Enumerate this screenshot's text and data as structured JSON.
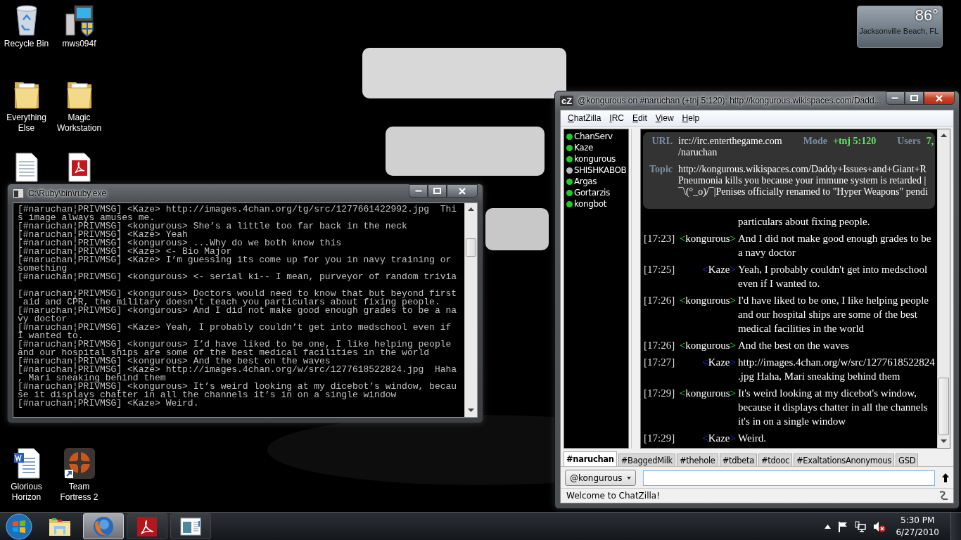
{
  "desktop": {
    "icons": [
      {
        "label": "Recycle Bin",
        "kind": "recycle"
      },
      {
        "label": "mws094f",
        "kind": "computer"
      },
      {
        "label": "Everything Else",
        "kind": "folder"
      },
      {
        "label": "Magic Workstation",
        "kind": "folder"
      },
      {
        "kind": "document"
      },
      {
        "kind": "pdf"
      },
      {
        "label": "Glorious Horizon",
        "kind": "word"
      },
      {
        "label": "Team Fortress 2",
        "kind": "game"
      }
    ]
  },
  "weather_gadget": {
    "temperature": "86°",
    "location": "Jacksonville Beach, FL"
  },
  "console_window": {
    "title": "C:\\Ruby\\bin\\ruby.exe",
    "blocks": [
      [
        "[#naruchan¦PRIVMSG] <Kaze> http://images.4chan.org/tg/src/1277661422992.jpg  Thi",
        "s image always amuses me.",
        "[#naruchan¦PRIVMSG] <kongurous> She’s a little too far back in the neck",
        "[#naruchan¦PRIVMSG] <Kaze> Yeah",
        "[#naruchan¦PRIVMSG] <kongurous> ...Why do we both know this",
        "[#naruchan¦PRIVMSG] <Kaze> <- Bio Major",
        "[#naruchan¦PRIVMSG] <Kaze> I’m guessing its come up for you in navy training or",
        "something",
        "[#naruchan¦PRIVMSG] <kongurous> <- serial ki-- I mean, purveyor of random trivia"
      ],
      [
        "[#naruchan¦PRIVMSG] <kongurous> Doctors would need to know that but beyond first",
        " aid and CPR, the military doesn’t teach you particulars about fixing people.",
        "[#naruchan¦PRIVMSG] <kongurous> And I did not make good enough grades to be a na",
        "vy doctor",
        "[#naruchan¦PRIVMSG] <Kaze> Yeah, I probably couldn’t get into medschool even if",
        "I wanted to.",
        "[#naruchan¦PRIVMSG] <kongurous> I’d have liked to be one, I like helping people",
        "and our hospital ships are some of the best medical facilities in the world",
        "[#naruchan¦PRIVMSG] <kongurous> And the best on the waves",
        "[#naruchan¦PRIVMSG] <Kaze> http://images.4chan.org/w/src/1277618522824.jpg  Haha",
        ", Mari sneaking behind them",
        "[#naruchan¦PRIVMSG] <kongurous> It’s weird looking at my dicebot’s window, becau",
        "se it displays chatter in all the channels it’s in on a single window",
        "[#naruchan¦PRIVMSG] <Kaze> Weird."
      ]
    ]
  },
  "chatzilla_window": {
    "app_icon": "cZ",
    "title": "@kongurous on #naruchan (+tnj 5:120): http://kongurous.wikispaces.com/Dadd...",
    "menu": [
      "ChatZilla",
      "IRC",
      "Edit",
      "View",
      "Help"
    ],
    "users": [
      {
        "nick": "ChanServ",
        "color": "#22cc22"
      },
      {
        "nick": "Kaze",
        "color": "#22cc22"
      },
      {
        "nick": "kongurous",
        "color": "#22cc22"
      },
      {
        "nick": "SHISHKABOB",
        "color": "#bbbbbb"
      },
      {
        "nick": "Argas",
        "color": "#22cc22"
      },
      {
        "nick": "Gortarzis",
        "color": "#22cc22"
      },
      {
        "nick": "kongbot",
        "color": "#22cc22"
      }
    ],
    "header": {
      "url_label": "URL",
      "url": [
        "irc://irc.enterthegame.com",
        "/naruchan"
      ],
      "mode_label": "Mode",
      "mode": "+tnj 5:120",
      "users_label": "Users",
      "users": "7,",
      "topic_label": "Topic",
      "topic": [
        "http://kongurous.wikispaces.com/Daddy+Issues+and+Giant+R",
        "Pneumonia kills you because your immune system is retarded |",
        "¯\\(°_o)/¯|Penises officially renamed to \"Hyper Weapons\" pendi"
      ]
    },
    "messages": [
      {
        "kind": "continuation",
        "text": "particulars about fixing people."
      },
      {
        "kind": "self",
        "time": "[17:23]",
        "open": "<",
        "nick": "kongurous",
        "close": ">",
        "text": "And I did not make good enough grades to be a navy doctor"
      },
      {
        "kind": "other",
        "time": "[17:25]",
        "open": "<",
        "nick": "Kaze",
        "close": ">",
        "text": "Yeah, I probably couldn't get into medschool even if I wanted to."
      },
      {
        "kind": "self",
        "time": "[17:26]",
        "open": "<",
        "nick": "kongurous",
        "close": ">",
        "text": "I'd have liked to be one, I like helping people and our hospital ships are some of the best medical facilities in the world"
      },
      {
        "kind": "self",
        "time": "[17:26]",
        "open": "<",
        "nick": "kongurous",
        "close": ">",
        "text": "And the best on the waves"
      },
      {
        "kind": "other",
        "time": "[17:27]",
        "open": "<",
        "nick": "Kaze",
        "close": ">",
        "text": "http://images.4chan.org/w/src/1277618522824.jpg  Haha, Mari sneaking behind them"
      },
      {
        "kind": "self",
        "time": "[17:29]",
        "open": "<",
        "nick": "kongurous",
        "close": ">",
        "text": "It's weird looking at my dicebot's window, because it displays chatter in all the channels it's in on a single window"
      },
      {
        "kind": "other",
        "time": "[17:29]",
        "open": "<",
        "nick": "Kaze",
        "close": ">",
        "text": "Weird."
      }
    ],
    "tabs": [
      {
        "label": "#naruchan",
        "selected": true
      },
      {
        "label": "#BaggedMilk",
        "selected": false
      },
      {
        "label": "#thehole",
        "selected": false
      },
      {
        "label": "#tdbeta",
        "selected": false
      },
      {
        "label": "#tdooc",
        "selected": false
      },
      {
        "label": "#ExaltationsAnonymous",
        "selected": false
      },
      {
        "label": "GSD",
        "selected": false
      }
    ],
    "nick_button": "@kongurous",
    "status": "Welcome to ChatZilla!"
  },
  "taskbar": {
    "apps": [
      {
        "kind": "explorer",
        "selected": false
      },
      {
        "kind": "firefox",
        "selected": true
      },
      {
        "kind": "pdf",
        "selected": false
      },
      {
        "kind": "window",
        "selected": false
      }
    ],
    "time": "5:30 PM",
    "date": "6/27/2010"
  }
}
